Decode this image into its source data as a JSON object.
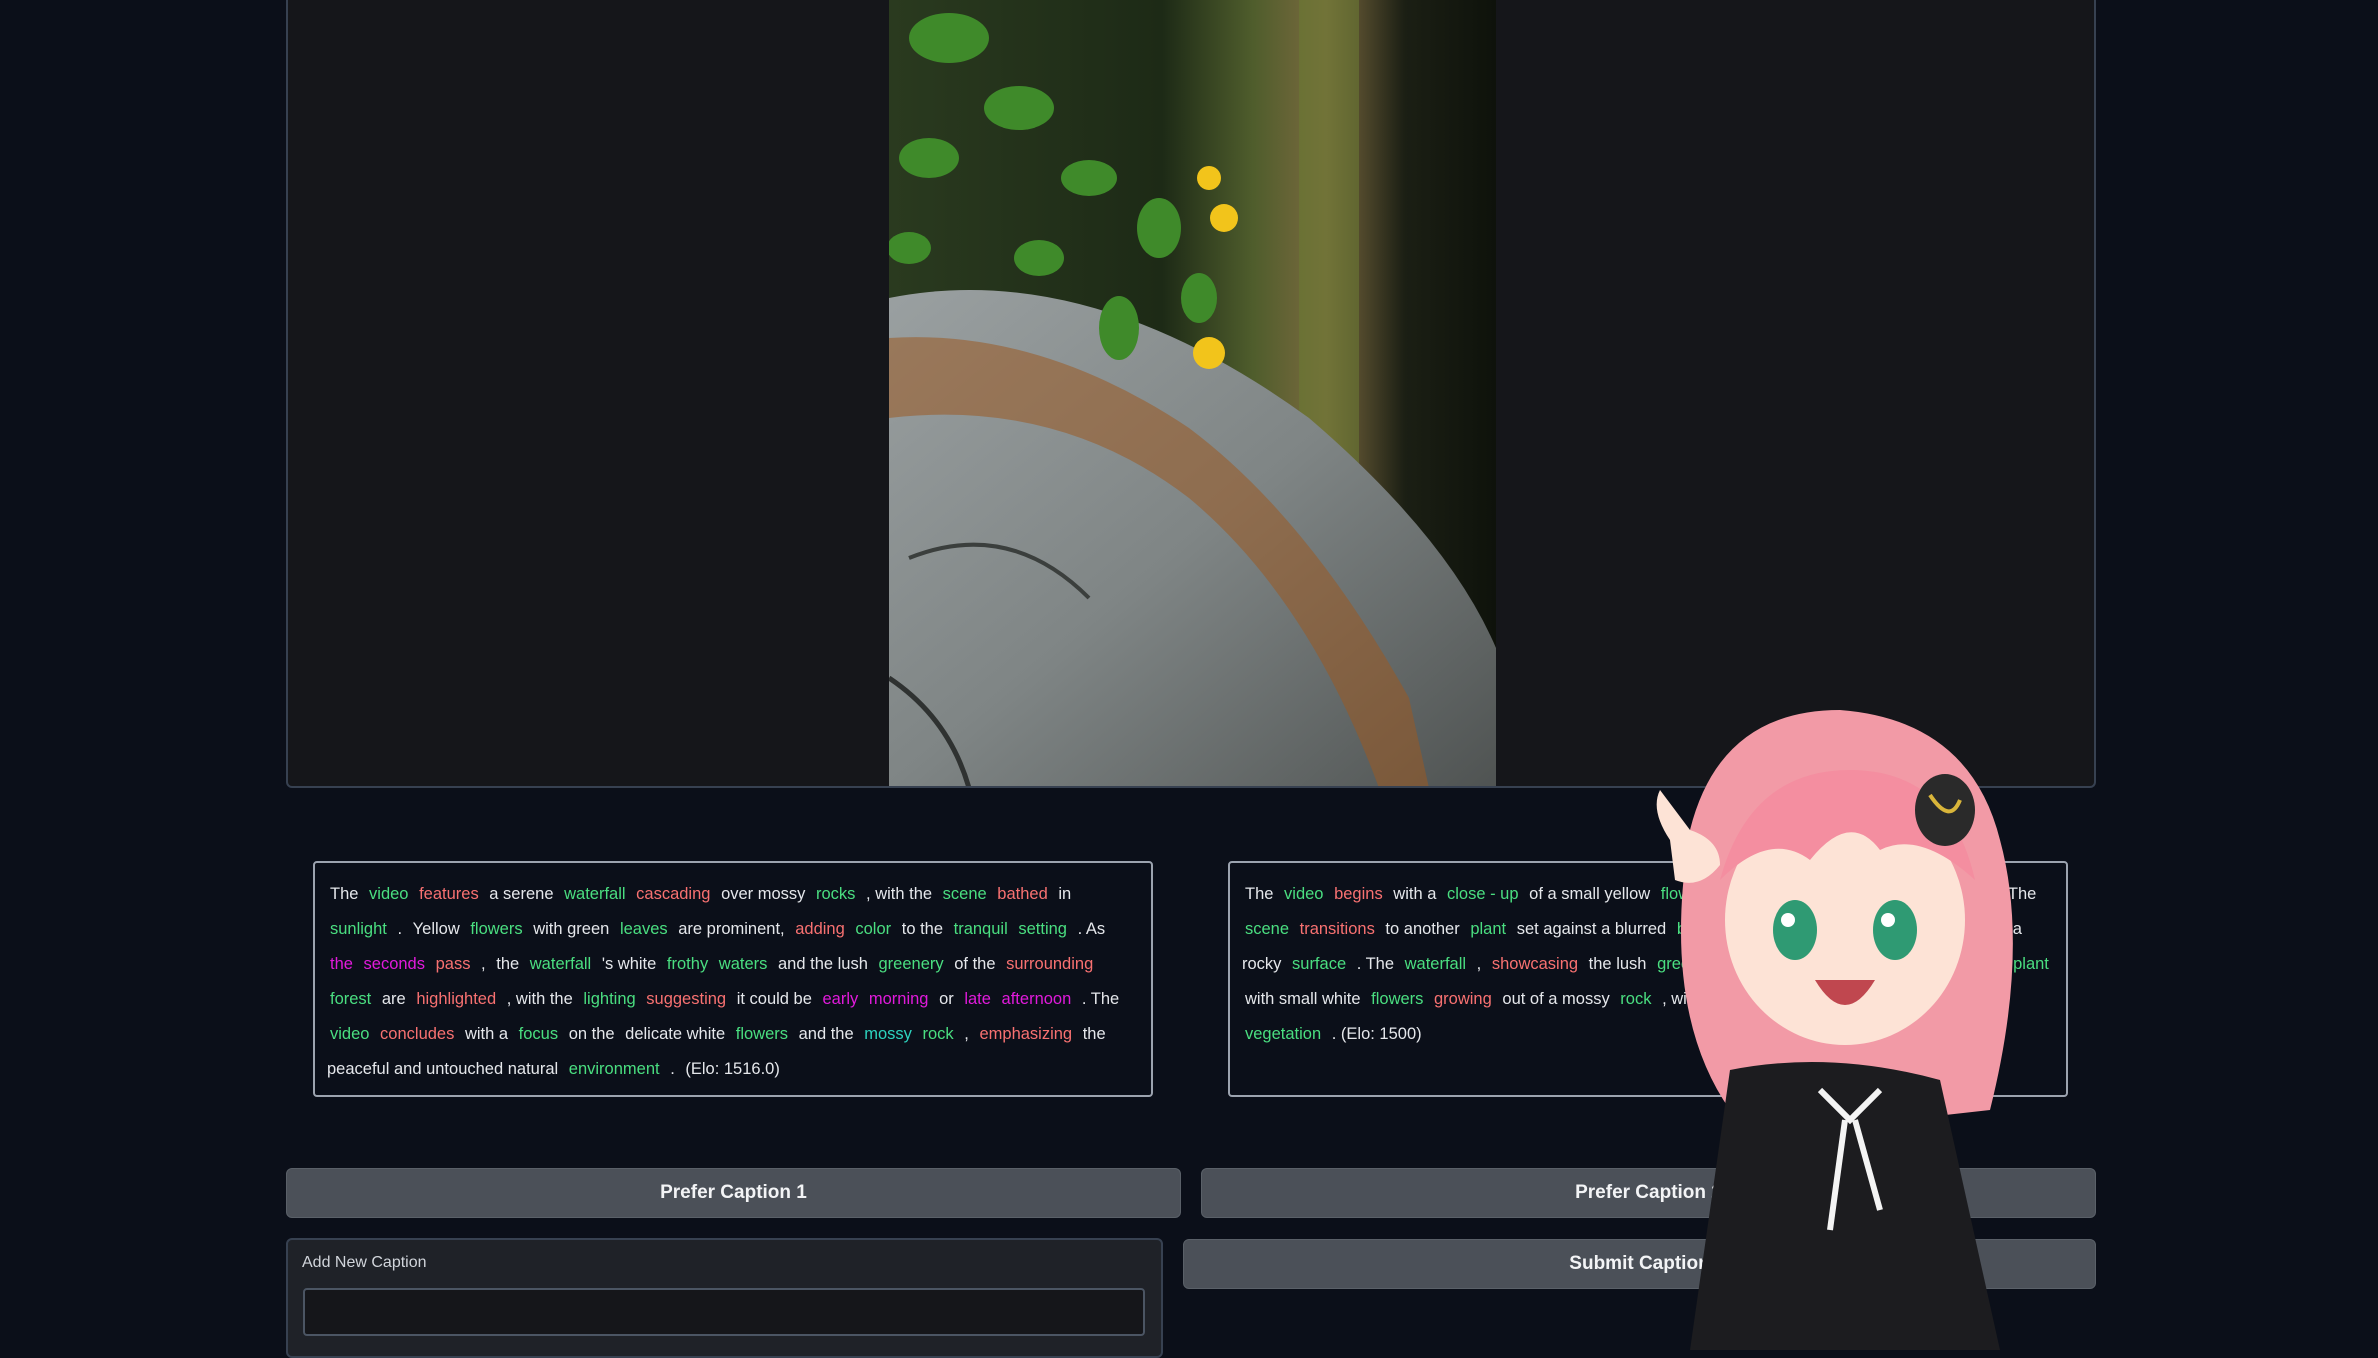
{
  "video": {
    "alt": "frame showing yellow flowers on a mossy rock"
  },
  "captions": [
    {
      "tokens": [
        {
          "text": "The",
          "c": "k"
        },
        {
          "text": "video",
          "c": "g"
        },
        {
          "text": "features",
          "c": "r"
        },
        {
          "text": "a serene",
          "c": "k"
        },
        {
          "text": "waterfall",
          "c": "g"
        },
        {
          "text": "cascading",
          "c": "r"
        },
        {
          "text": "over mossy",
          "c": "k"
        },
        {
          "text": "rocks",
          "c": "g"
        },
        {
          "text": ", with the",
          "c": "k"
        },
        {
          "text": "scene",
          "c": "g"
        },
        {
          "text": "bathed",
          "c": "r"
        },
        {
          "text": "in",
          "c": "k"
        },
        {
          "text": "sunlight",
          "c": "g"
        },
        {
          "text": ".",
          "c": "k"
        },
        {
          "text": "Yellow",
          "c": "k"
        },
        {
          "text": "flowers",
          "c": "g"
        },
        {
          "text": "with green",
          "c": "k"
        },
        {
          "text": "leaves",
          "c": "g"
        },
        {
          "text": "are prominent,",
          "c": "k"
        },
        {
          "text": "adding",
          "c": "r"
        },
        {
          "text": "color",
          "c": "g"
        },
        {
          "text": "to the",
          "c": "k"
        },
        {
          "text": "tranquil",
          "c": "g"
        },
        {
          "text": "setting",
          "c": "g"
        },
        {
          "text": ". As",
          "c": "k"
        },
        {
          "text": "the",
          "c": "m"
        },
        {
          "text": "seconds",
          "c": "m"
        },
        {
          "text": "pass",
          "c": "r"
        },
        {
          "text": ",",
          "c": "k"
        },
        {
          "text": "the",
          "c": "k"
        },
        {
          "text": "waterfall",
          "c": "g"
        },
        {
          "text": "'s white",
          "c": "k"
        },
        {
          "text": "frothy",
          "c": "g"
        },
        {
          "text": "waters",
          "c": "g"
        },
        {
          "text": "and the lush",
          "c": "k"
        },
        {
          "text": "greenery",
          "c": "g"
        },
        {
          "text": "of the",
          "c": "k"
        },
        {
          "text": "surrounding",
          "c": "r"
        },
        {
          "text": "forest",
          "c": "g"
        },
        {
          "text": "are",
          "c": "k"
        },
        {
          "text": "highlighted",
          "c": "r"
        },
        {
          "text": ", with the",
          "c": "k"
        },
        {
          "text": "lighting",
          "c": "g"
        },
        {
          "text": "suggesting",
          "c": "r"
        },
        {
          "text": "it could be",
          "c": "k"
        },
        {
          "text": "early",
          "c": "m"
        },
        {
          "text": "morning",
          "c": "m"
        },
        {
          "text": "or",
          "c": "k"
        },
        {
          "text": "late",
          "c": "m"
        },
        {
          "text": "afternoon",
          "c": "m"
        },
        {
          "text": ". The",
          "c": "k"
        },
        {
          "text": "video",
          "c": "g"
        },
        {
          "text": "concludes",
          "c": "r"
        },
        {
          "text": "with a",
          "c": "k"
        },
        {
          "text": "focus",
          "c": "g"
        },
        {
          "text": "on the",
          "c": "k"
        },
        {
          "text": "delicate white",
          "c": "k"
        },
        {
          "text": "flowers",
          "c": "g"
        },
        {
          "text": "and the",
          "c": "k"
        },
        {
          "text": "mossy",
          "c": "t"
        },
        {
          "text": "rock",
          "c": "g"
        },
        {
          "text": ",",
          "c": "k"
        },
        {
          "text": "emphasizing",
          "c": "r"
        },
        {
          "text": "the peaceful and untouched natural",
          "c": "k"
        },
        {
          "text": "environment",
          "c": "g"
        },
        {
          "text": ".",
          "c": "k"
        },
        {
          "text": "(Elo: 1516.0)",
          "c": "k"
        }
      ]
    },
    {
      "tokens": [
        {
          "text": "The",
          "c": "k"
        },
        {
          "text": "video",
          "c": "g"
        },
        {
          "text": "begins",
          "c": "r"
        },
        {
          "text": "with a",
          "c": "k"
        },
        {
          "text": "close - up",
          "c": "g"
        },
        {
          "text": "of a small yellow",
          "c": "k"
        },
        {
          "text": "flower",
          "c": "g"
        },
        {
          "text": "bloom",
          "c": "r"
        },
        {
          "text": "surrounded",
          "c": "r"
        },
        {
          "text": "by green",
          "c": "k"
        },
        {
          "text": "foliage",
          "c": "g"
        },
        {
          "text": ". The",
          "c": "k"
        },
        {
          "text": "scene",
          "c": "g"
        },
        {
          "text": "transitions",
          "c": "r"
        },
        {
          "text": "to another",
          "c": "k"
        },
        {
          "text": "plant",
          "c": "g"
        },
        {
          "text": "set against a blurred",
          "c": "k"
        },
        {
          "text": "background",
          "c": "g"
        },
        {
          "text": "of a",
          "c": "k"
        },
        {
          "text": "waterfall",
          "c": "g"
        },
        {
          "text": "cascading",
          "c": "r"
        },
        {
          "text": "down a rocky",
          "c": "k"
        },
        {
          "text": "surface",
          "c": "g"
        },
        {
          "text": ". The",
          "c": "k"
        },
        {
          "text": "waterfall",
          "c": "g"
        },
        {
          "text": ",",
          "c": "k"
        },
        {
          "text": "showcasing",
          "c": "r"
        },
        {
          "text": "the lush",
          "c": "k"
        },
        {
          "text": "greenery",
          "c": "g"
        },
        {
          "text": "and moss-",
          "c": "k"
        },
        {
          "text": "covered",
          "c": "r"
        },
        {
          "text": "rocks, then of a",
          "c": "k"
        },
        {
          "text": "plant",
          "c": "g"
        },
        {
          "text": "with small white",
          "c": "k"
        },
        {
          "text": "flowers",
          "c": "g"
        },
        {
          "text": "growing",
          "c": "r"
        },
        {
          "text": "out of a mossy",
          "c": "k"
        },
        {
          "text": "rock",
          "c": "g"
        },
        {
          "text": ", with more",
          "c": "k"
        },
        {
          "text": "flowers",
          "c": "g"
        },
        {
          "text": "and the",
          "c": "k"
        },
        {
          "text": "surrounding",
          "c": "r"
        },
        {
          "text": "vegetation",
          "c": "g"
        },
        {
          "text": ". (Elo: 1500)",
          "c": "k"
        }
      ]
    }
  ],
  "buttons": {
    "prefer1": "Prefer Caption 1",
    "prefer2": "Prefer Caption 2",
    "submit": "Submit Caption"
  },
  "add_caption": {
    "label": "Add New Caption",
    "value": "",
    "placeholder": ""
  }
}
